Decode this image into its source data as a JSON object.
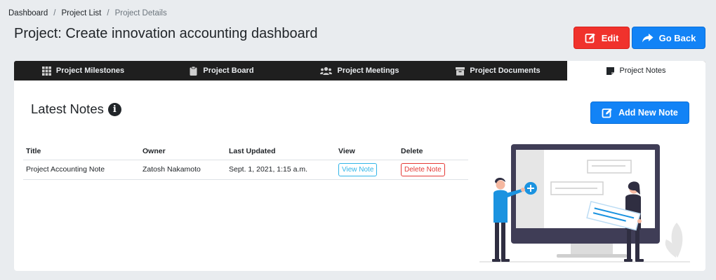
{
  "breadcrumb": {
    "items": [
      "Dashboard",
      "Project List"
    ],
    "current": "Project Details",
    "separator": "/"
  },
  "page": {
    "title": "Project: Create innovation accounting dashboard"
  },
  "actions": {
    "edit_label": "Edit",
    "back_label": "Go Back"
  },
  "tabs": [
    {
      "label": "Project Milestones",
      "icon": "grid-icon",
      "active": false
    },
    {
      "label": "Project Board",
      "icon": "clipboard-icon",
      "active": false
    },
    {
      "label": "Project Meetings",
      "icon": "users-icon",
      "active": false
    },
    {
      "label": "Project Documents",
      "icon": "archive-icon",
      "active": false
    },
    {
      "label": "Project Notes",
      "icon": "sticky-note-icon",
      "active": true
    }
  ],
  "notes": {
    "heading": "Latest Notes",
    "add_label": "Add New Note",
    "columns": [
      "Title",
      "Owner",
      "Last Updated",
      "View",
      "Delete"
    ],
    "rows": [
      {
        "title": "Project Accounting Note",
        "owner": "Zatosh Nakamoto",
        "updated": "Sept. 1, 2021, 1:15 a.m.",
        "view_label": "View Note",
        "delete_label": "Delete Note"
      }
    ]
  },
  "colors": {
    "danger": "#f0322c",
    "primary": "#1283f6",
    "tabbar": "#1f1f1f",
    "background": "#e9ecef",
    "info": "#31b5e8"
  }
}
